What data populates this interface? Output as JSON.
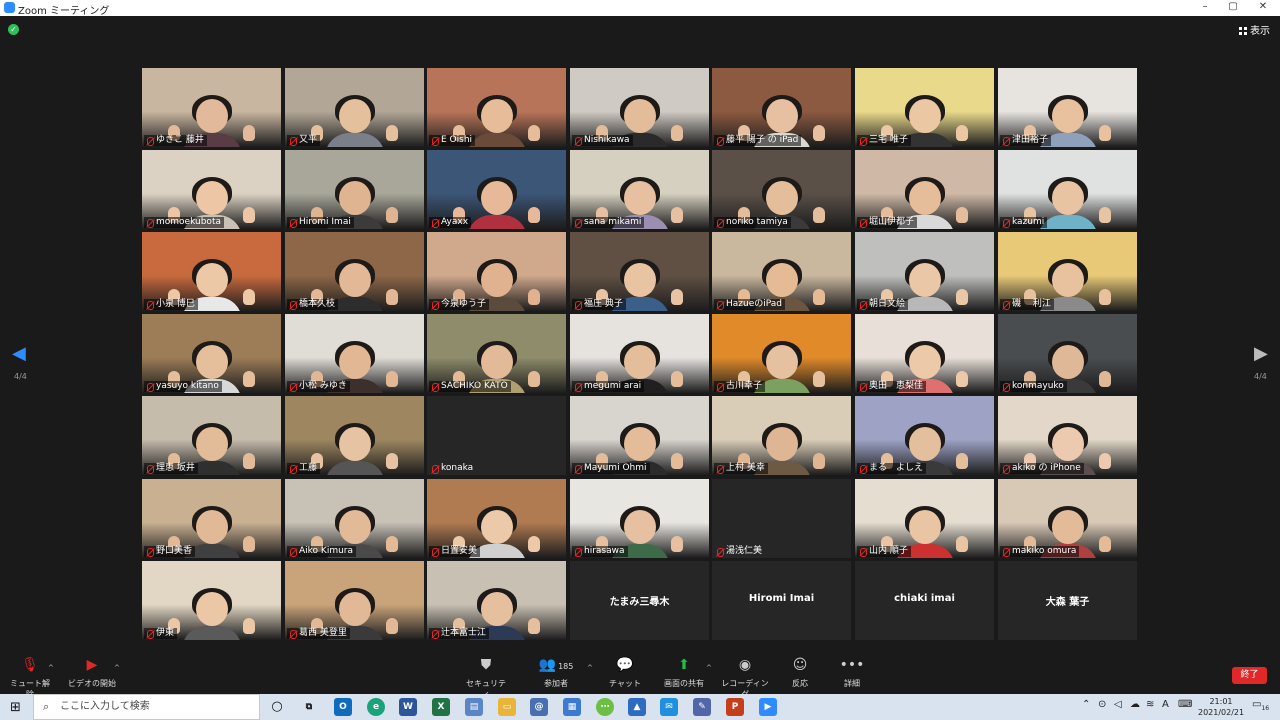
{
  "window": {
    "title": "Zoom ミーティング",
    "controls": [
      "–",
      "▢",
      "✕"
    ]
  },
  "meeting": {
    "view_label": "表示",
    "page_indicator": "4/4"
  },
  "participants": [
    {
      "name": "ゆきこ 藤井",
      "video": true,
      "bg": "#c9b6a0",
      "skin": "#e2b99a",
      "shirt": "#5a3c45"
    },
    {
      "name": "又平",
      "video": true,
      "bg": "#b2a796",
      "skin": "#e4c09d",
      "shirt": "#7a7f89"
    },
    {
      "name": "E Oishi",
      "video": true,
      "bg": "#b87458",
      "skin": "#e6bd98",
      "shirt": "#6a4b3a"
    },
    {
      "name": "Nishikawa",
      "video": true,
      "bg": "#cfcac3",
      "skin": "#e3bd9a",
      "shirt": "#2a2a2a"
    },
    {
      "name": "藤平 陽子 の iPad",
      "video": true,
      "bg": "#8c5a40",
      "skin": "#e6c0a0",
      "shirt": "#d8d8d0"
    },
    {
      "name": "三宅 唯子",
      "video": true,
      "bg": "#e9d98a",
      "skin": "#ecc7a4",
      "shirt": "#333333"
    },
    {
      "name": "津田裕子",
      "video": true,
      "bg": "#e7e4df",
      "skin": "#e8c29e",
      "shirt": "#8fa1ba"
    },
    {
      "name": "momoekubota",
      "video": true,
      "bg": "#dcd2c3",
      "skin": "#ecc6a5",
      "shirt": "#c9c0b6"
    },
    {
      "name": "Hiromi Imai",
      "video": true,
      "bg": "#a8a79a",
      "skin": "#dfb591",
      "shirt": "#3b3b3b"
    },
    {
      "name": "Ayaxx",
      "video": true,
      "bg": "#3c5677",
      "skin": "#e8b998",
      "shirt": "#b03040"
    },
    {
      "name": "sana mikami",
      "video": true,
      "bg": "#d6d0c0",
      "skin": "#e6c0a0",
      "shirt": "#9a8fb0"
    },
    {
      "name": "noriko tamiya",
      "video": true,
      "bg": "#5a5048",
      "skin": "#e4bd9b",
      "shirt": "#3a3a3a"
    },
    {
      "name": "堀山伊都子",
      "video": true,
      "bg": "#cfb9a6",
      "skin": "#e6bd9a",
      "shirt": "#d9d9d9"
    },
    {
      "name": "kazumi",
      "video": true,
      "bg": "#dfe2e0",
      "skin": "#e8c4a2",
      "shirt": "#6fb2c7"
    },
    {
      "name": "小泉 博巳",
      "video": true,
      "bg": "#c96a3e",
      "skin": "#ecc8a7",
      "shirt": "#e8e8e8"
    },
    {
      "name": "橋本久枝",
      "video": true,
      "bg": "#8d6747",
      "skin": "#e2b897",
      "shirt": "#2d2d2d"
    },
    {
      "name": "今泉ゆう子",
      "video": true,
      "bg": "#d0a88c",
      "skin": "#e0b28f",
      "shirt": "#5b4b3d"
    },
    {
      "name": "福庄 典子",
      "video": true,
      "bg": "#5f5043",
      "skin": "#e8c4a3",
      "shirt": "#3c5f8a"
    },
    {
      "name": "HazueのiPad",
      "video": true,
      "bg": "#c9b79e",
      "skin": "#e4bb95",
      "shirt": "#6b5642"
    },
    {
      "name": "朝日文絵",
      "video": true,
      "bg": "#bfbfbd",
      "skin": "#eac7a6",
      "shirt": "#b8b8b8"
    },
    {
      "name": "磯 　利江",
      "video": true,
      "bg": "#e8c977",
      "skin": "#e8c19f",
      "shirt": "#8a8a8a"
    },
    {
      "name": "yasuyo kitano",
      "video": true,
      "bg": "#9d7d57",
      "skin": "#e5bf9c",
      "shirt": "#d8d8d8"
    },
    {
      "name": "小松 みゆき",
      "video": true,
      "bg": "#e0dcd6",
      "skin": "#e2b894",
      "shirt": "#3d2f2c"
    },
    {
      "name": "SACHIKO KATO",
      "video": true,
      "bg": "#8e8c6b",
      "skin": "#e3ba97",
      "shirt": "#b0a070"
    },
    {
      "name": "megumi arai",
      "video": true,
      "bg": "#e6e3df",
      "skin": "#e4bd9a",
      "shirt": "#202020"
    },
    {
      "name": "古川幸子",
      "video": true,
      "bg": "#e08a2a",
      "skin": "#e6c19f",
      "shirt": "#7ca060"
    },
    {
      "name": "奥田　恵梨佳",
      "video": true,
      "bg": "#e8e0d8",
      "skin": "#ecc9a8",
      "shirt": "#e07070"
    },
    {
      "name": "konmayuko",
      "video": true,
      "bg": "#4a4d50",
      "skin": "#dfb897",
      "shirt": "#3a3a3a"
    },
    {
      "name": "理恵 坂井",
      "video": true,
      "bg": "#c6bcab",
      "skin": "#e2bb98",
      "shirt": "#2f2f2f"
    },
    {
      "name": "工藤",
      "video": true,
      "bg": "#9e8760",
      "skin": "#e6c3a2",
      "shirt": "#555555"
    },
    {
      "name": "konaka",
      "video": false,
      "bg": "#262626",
      "skin": "#000",
      "shirt": "#000"
    },
    {
      "name": "Mayumi Ohmi",
      "video": true,
      "bg": "#d8d4ce",
      "skin": "#e4bc99",
      "shirt": "#2b2b2b"
    },
    {
      "name": "上村 美幸",
      "video": true,
      "bg": "#d9cdb8",
      "skin": "#dfb694",
      "shirt": "#6d5a45"
    },
    {
      "name": "まる　よしえ",
      "video": true,
      "bg": "#9ea3c6",
      "skin": "#e4bf9d",
      "shirt": "#3a3a3a"
    },
    {
      "name": "akiko の iPhone",
      "video": true,
      "bg": "#e2d7c8",
      "skin": "#eccab0",
      "shirt": "#5b5050"
    },
    {
      "name": "野口美香",
      "video": true,
      "bg": "#c8b091",
      "skin": "#e2b996",
      "shirt": "#404040"
    },
    {
      "name": "Aiko Kimura",
      "video": true,
      "bg": "#c7c1b6",
      "skin": "#e3ba98",
      "shirt": "#4a4a4a"
    },
    {
      "name": "日置安美",
      "video": true,
      "bg": "#b07b51",
      "skin": "#ecc9a9",
      "shirt": "#d0d0d0"
    },
    {
      "name": "hirasawa",
      "video": true,
      "bg": "#e8e6e0",
      "skin": "#e6c0a0",
      "shirt": "#3d6b4a"
    },
    {
      "name": "湯浅仁美",
      "video": false,
      "bg": "#262626",
      "skin": "#000",
      "shirt": "#000"
    },
    {
      "name": "山内 順子",
      "video": true,
      "bg": "#e4ddd0",
      "skin": "#e9c5a4",
      "shirt": "#cc3030"
    },
    {
      "name": "makiko omura",
      "video": true,
      "bg": "#d8c8b6",
      "skin": "#e3bb98",
      "shirt": "#b04040"
    },
    {
      "name": "伊東",
      "video": true,
      "bg": "#e2d7c4",
      "skin": "#ebc7a6",
      "shirt": "#5a5a5a"
    },
    {
      "name": "葛西 美登里",
      "video": true,
      "bg": "#c9a47a",
      "skin": "#e2b996",
      "shirt": "#3a3a3a"
    },
    {
      "name": "辻本富士江",
      "video": true,
      "bg": "#c8c0b2",
      "skin": "#e6c09e",
      "shirt": "#2c3a55"
    },
    {
      "name": "たまみ三尋木",
      "video": false,
      "bg": "#262626",
      "skin": "#000",
      "shirt": "#000",
      "center_name": true
    },
    {
      "name": "Hiromi Imai",
      "video": false,
      "bg": "#262626",
      "skin": "#000",
      "shirt": "#000",
      "center_name": true
    },
    {
      "name": "chiaki imai",
      "video": false,
      "bg": "#262626",
      "skin": "#000",
      "shirt": "#000",
      "center_name": true
    },
    {
      "name": "大森 葉子",
      "video": false,
      "bg": "#262626",
      "skin": "#000",
      "shirt": "#000",
      "center_name": true
    }
  ],
  "toolbar": {
    "mute": {
      "label": "ミュート解除",
      "icon": "microphone-muted-icon"
    },
    "video": {
      "label": "ビデオの開始",
      "icon": "video-off-icon"
    },
    "security": {
      "label": "セキュリティ",
      "icon": "shield-icon"
    },
    "participants": {
      "label": "参加者",
      "count": "185",
      "icon": "people-icon"
    },
    "chat": {
      "label": "チャット",
      "icon": "chat-icon"
    },
    "share": {
      "label": "画面の共有",
      "icon": "share-screen-icon"
    },
    "record": {
      "label": "レコーディング",
      "icon": "record-icon"
    },
    "reactions": {
      "label": "反応",
      "icon": "emoji-icon"
    },
    "more": {
      "label": "詳細",
      "icon": "more-icon"
    },
    "end_label": "終了"
  },
  "taskbar": {
    "search_placeholder": "ここに入力して検索",
    "time": "21:01",
    "date": "2021/02/21",
    "ime": "A",
    "notif_count": "16"
  }
}
